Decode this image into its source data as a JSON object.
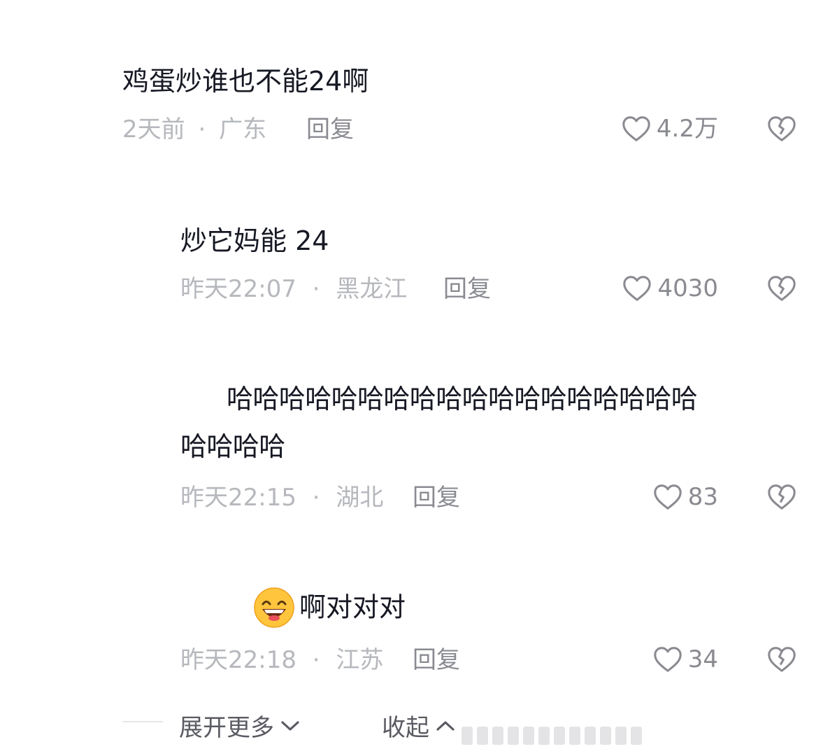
{
  "comments": [
    {
      "text": "鸡蛋炒谁也不能24啊",
      "time": "2天前",
      "sep": "·",
      "region": "广东",
      "reply": "回复",
      "likes": "4.2万"
    },
    {
      "text": "炒它妈能 24",
      "time": "昨天22:07",
      "sep": "·",
      "region": "黑龙江",
      "reply": "回复",
      "likes": "4030"
    },
    {
      "text_line1": "哈哈哈哈哈哈哈哈哈哈哈哈哈哈哈哈哈哈",
      "text_line2": "哈哈哈哈",
      "time": "昨天22:15",
      "sep": "·",
      "region": "湖北",
      "reply": "回复",
      "likes": "83"
    },
    {
      "text": "啊对对对",
      "emoji": "grinning-face-emoji",
      "time": "昨天22:18",
      "sep": "·",
      "region": "江苏",
      "reply": "回复",
      "likes": "34"
    }
  ],
  "footer": {
    "expand_label": "展开更多",
    "collapse_label": "收起"
  },
  "icons": {
    "like": "heart-outline-icon",
    "dislike": "broken-heart-icon"
  },
  "colors": {
    "text": "#161823",
    "meta": "#b6b8bd",
    "action": "#8a8b91"
  }
}
